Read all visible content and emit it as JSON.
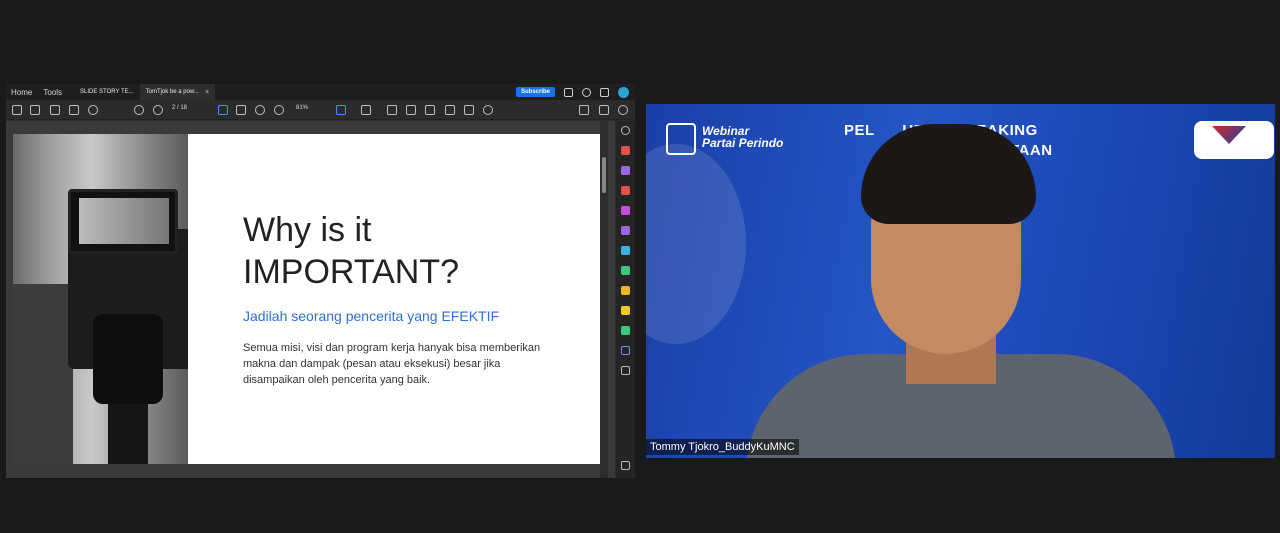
{
  "viewer": {
    "menu": {
      "home": "Home",
      "tools": "Tools"
    },
    "tabs": [
      {
        "label": "SLIDE STORY TE..."
      },
      {
        "label": "TomTjok be a pow...",
        "close": "×"
      }
    ],
    "subscribe_label": "Subscribe",
    "toolbar": {
      "page": "2  / 18",
      "zoom": "81%"
    }
  },
  "slide": {
    "title_line1": "Why is it",
    "title_line2": "IMPORTANT?",
    "subtitle": "Jadilah seorang pencerita yang EFEKTIF",
    "body": "Semua misi, visi dan program kerja hanyak bisa memberikan makna dan dampak (pesan atau eksekusi) besar jika disampaikan oleh pencerita yang baik."
  },
  "webcam": {
    "logo_line1": "Webinar",
    "logo_line2": "Partai Perindo",
    "banner_line1": "PEL      UBLIC SPEAKING",
    "banner_line2": "RITAAN",
    "participant_name": "Tommy Tjokro_BuddyKuMNC"
  },
  "colors": {
    "accent_blue": "#2f6fd6",
    "subscribe": "#1473e6",
    "webcam_bg": "#2456c5"
  }
}
